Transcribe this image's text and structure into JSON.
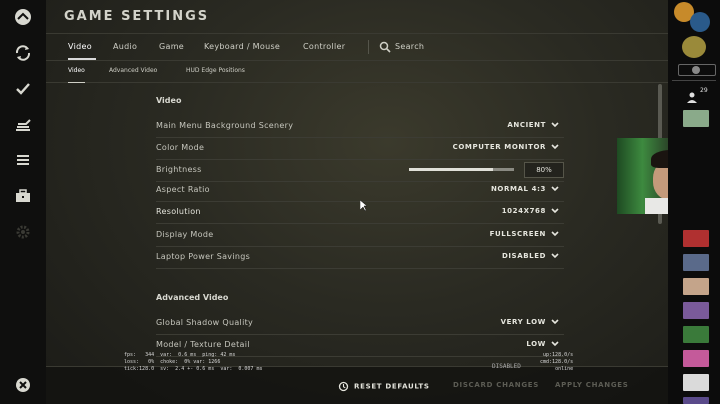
{
  "title": "GAME SETTINGS",
  "tabs": [
    {
      "label": "Video",
      "active": true
    },
    {
      "label": "Audio"
    },
    {
      "label": "Game"
    },
    {
      "label": "Keyboard / Mouse"
    },
    {
      "label": "Controller"
    }
  ],
  "search_label": "Search",
  "subtabs": [
    {
      "label": "Video",
      "active": true
    },
    {
      "label": "Advanced Video"
    },
    {
      "label": "HUD Edge Positions"
    }
  ],
  "sections": {
    "video": "Video",
    "advanced": "Advanced Video"
  },
  "settings": {
    "main_menu_bg": {
      "label": "Main Menu Background Scenery",
      "value": "ANCIENT"
    },
    "color_mode": {
      "label": "Color Mode",
      "value": "COMPUTER MONITOR"
    },
    "brightness": {
      "label": "Brightness",
      "value": "80%",
      "level": 0.8
    },
    "aspect_ratio": {
      "label": "Aspect Ratio",
      "value": "NORMAL 4:3"
    },
    "resolution": {
      "label": "Resolution",
      "value": "1024X768"
    },
    "display_mode": {
      "label": "Display Mode",
      "value": "FULLSCREEN"
    },
    "laptop_power": {
      "label": "Laptop Power Savings",
      "value": "DISABLED"
    },
    "shadow_quality": {
      "label": "Global Shadow Quality",
      "value": "VERY LOW"
    },
    "model_texture": {
      "label": "Model / Texture Detail",
      "value": "LOW"
    }
  },
  "footer": {
    "reset": "RESET DEFAULTS",
    "discard": "DISCARD CHANGES",
    "apply": "APPLY CHANGES"
  },
  "debug_left": "fps:   344  var:  0.6 ms  ping: 42 ms\nloss:   0%  choke:  0% var: 1266\ntick:128.0  sv:  2.4 +- 0.6 ms  var:  0.007 ms",
  "debug_right": "up:128.0/s\ncmd:128.0/s\nonline",
  "debug_partial": "DISABLED",
  "friends_count": "29",
  "colors": {
    "accent": "#e0e0d8",
    "background": "#2a2a22",
    "rail": "#0f0f0e"
  },
  "icons": {
    "left_rail": [
      "play-icon",
      "refresh-icon",
      "check-icon",
      "inventory-icon",
      "list-icon",
      "briefcase-icon",
      "gear-icon",
      "close-icon"
    ]
  }
}
